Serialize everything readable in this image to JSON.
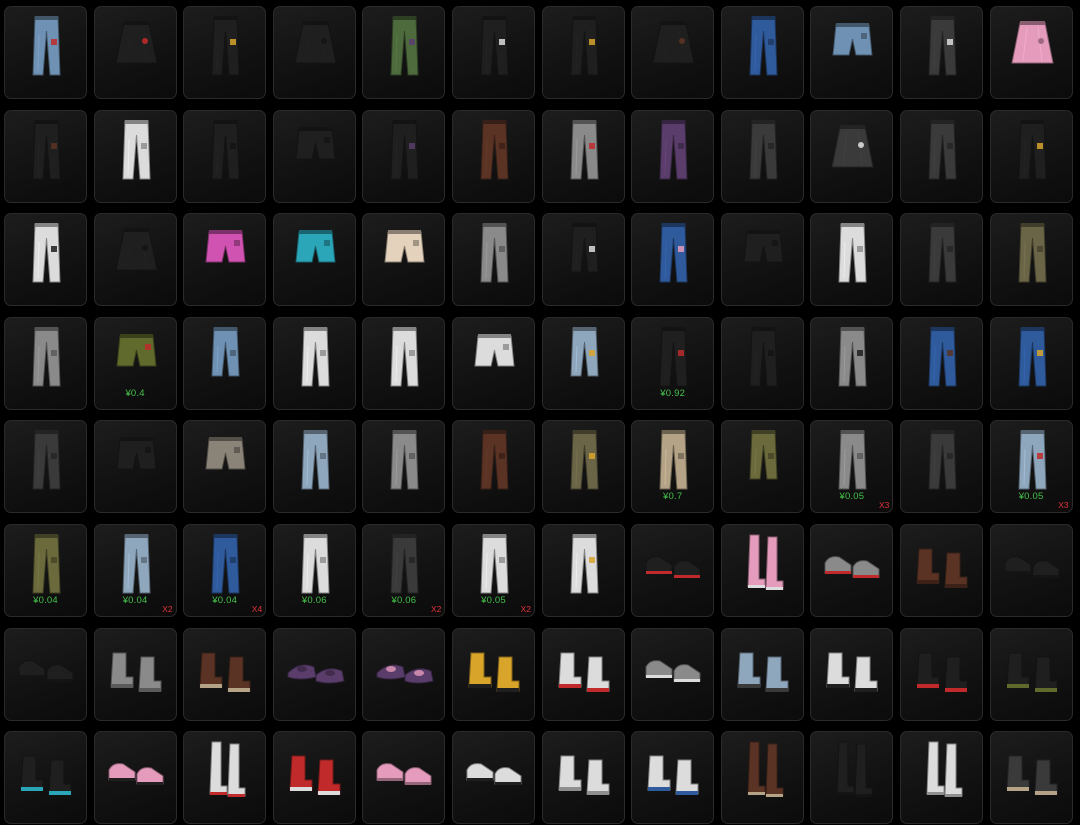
{
  "palette": {
    "green": "#4d6b3c",
    "black": "#1f1f1f",
    "darkgray": "#3a3a3a",
    "white": "#dcdcdc",
    "blue": "#2f5a9c",
    "denim": "#6f91b3",
    "lightdenim": "#8fa7bd",
    "gray": "#8a8a8a",
    "pink": "#e59bbb",
    "brown": "#5a3324",
    "tan": "#b4a386",
    "khaki": "#6b6a3c",
    "olive": "#5f6a2c",
    "camo": "#6b6547",
    "cream": "#e4d2bd",
    "teal": "#2aa6b8",
    "rainbow": "#d052b1",
    "plaid": "#8a8378",
    "purple": "#5a3d6b",
    "red": "#c02a2a",
    "yellow": "#d8a42a",
    "accent_price": "#45c24a",
    "accent_qty": "#e0343a"
  },
  "items": [
    {
      "name": "patched-jeans-icon",
      "kind": "pants",
      "color": "denim",
      "accent": "red"
    },
    {
      "name": "studded-skirt-icon",
      "kind": "skirt",
      "color": "black",
      "accent": "red"
    },
    {
      "name": "chain-pants-icon",
      "kind": "pants",
      "color": "black",
      "accent": "yellow"
    },
    {
      "name": "drape-skirt-icon",
      "kind": "skirt",
      "color": "black"
    },
    {
      "name": "green-cargo-pants-icon",
      "kind": "pants",
      "color": "green",
      "accent": "purple"
    },
    {
      "name": "strap-pants-icon",
      "kind": "pants",
      "color": "black",
      "accent": "white"
    },
    {
      "name": "stripe-pants-icon",
      "kind": "pants",
      "color": "black",
      "accent": "yellow"
    },
    {
      "name": "leather-skirt-icon",
      "kind": "skirt",
      "color": "black",
      "accent": "brown"
    },
    {
      "name": "blue-jeans-icon",
      "kind": "pants",
      "color": "blue"
    },
    {
      "name": "denim-shorts-icon",
      "kind": "shorts",
      "color": "denim"
    },
    {
      "name": "graphic-jeans-icon",
      "kind": "pants",
      "color": "darkgray",
      "accent": "white"
    },
    {
      "name": "pink-wrap-skirt-icon",
      "kind": "skirt",
      "color": "pink"
    },
    {
      "name": "ripped-pants-icon",
      "kind": "pants",
      "color": "black",
      "accent": "brown"
    },
    {
      "name": "white-pants-icon",
      "kind": "pants",
      "color": "white"
    },
    {
      "name": "black-leggings-icon",
      "kind": "pants",
      "color": "black"
    },
    {
      "name": "leather-shorts-icon",
      "kind": "shorts",
      "color": "black"
    },
    {
      "name": "tied-pants-icon",
      "kind": "pants",
      "color": "black",
      "accent": "purple"
    },
    {
      "name": "tights-icon",
      "kind": "pants",
      "color": "brown"
    },
    {
      "name": "armored-pants-icon",
      "kind": "pants",
      "color": "gray",
      "accent": "red"
    },
    {
      "name": "purple-pants-icon",
      "kind": "pants",
      "color": "purple"
    },
    {
      "name": "biker-pants-icon",
      "kind": "pants",
      "color": "darkgray"
    },
    {
      "name": "mesh-skirt-icon",
      "kind": "skirt",
      "color": "darkgray",
      "accent": "white"
    },
    {
      "name": "gray-jeans-icon",
      "kind": "pants",
      "color": "darkgray"
    },
    {
      "name": "gold-leggings-icon",
      "kind": "pants",
      "color": "black",
      "accent": "yellow"
    },
    {
      "name": "track-pants-icon",
      "kind": "pants",
      "color": "white",
      "accent": "black"
    },
    {
      "name": "pleated-skirt-icon",
      "kind": "skirt",
      "color": "black"
    },
    {
      "name": "rainbow-shorts-icon",
      "kind": "shorts",
      "color": "rainbow"
    },
    {
      "name": "teal-shorts-icon",
      "kind": "shorts",
      "color": "teal"
    },
    {
      "name": "bloomers-icon",
      "kind": "shorts",
      "color": "cream"
    },
    {
      "name": "skirt-leggings-icon",
      "kind": "pants",
      "color": "gray"
    },
    {
      "name": "black-capri-icon",
      "kind": "capri",
      "color": "black",
      "accent": "white"
    },
    {
      "name": "painted-jeans-icon",
      "kind": "pants",
      "color": "blue",
      "accent": "pink"
    },
    {
      "name": "black-shorts-icon",
      "kind": "shorts",
      "color": "black"
    },
    {
      "name": "white-leggings-icon",
      "kind": "pants",
      "color": "white"
    },
    {
      "name": "charcoal-jeans-icon",
      "kind": "pants",
      "color": "darkgray"
    },
    {
      "name": "camo-pants-icon",
      "kind": "pants",
      "color": "camo"
    },
    {
      "name": "gray-slacks-icon",
      "kind": "pants",
      "color": "gray"
    },
    {
      "name": "cargo-shorts-icon",
      "kind": "shorts",
      "color": "olive",
      "accent": "red",
      "price": "¥0.4"
    },
    {
      "name": "rolled-jeans-icon",
      "kind": "capri",
      "color": "denim"
    },
    {
      "name": "white-skinny-icon",
      "kind": "pants",
      "color": "white"
    },
    {
      "name": "light-jeans-icon",
      "kind": "pants",
      "color": "white"
    },
    {
      "name": "white-shorts-icon",
      "kind": "shorts",
      "color": "white"
    },
    {
      "name": "bleached-jeans-icon",
      "kind": "capri",
      "color": "lightdenim",
      "accent": "yellow"
    },
    {
      "name": "red-stripe-pants-icon",
      "kind": "pants",
      "color": "black",
      "accent": "red",
      "price": "¥0.92"
    },
    {
      "name": "dark-cargo-icon",
      "kind": "pants",
      "color": "black"
    },
    {
      "name": "grunge-pants-icon",
      "kind": "pants",
      "color": "gray",
      "accent": "black"
    },
    {
      "name": "holster-jeans-icon",
      "kind": "pants",
      "color": "blue",
      "accent": "brown"
    },
    {
      "name": "patch-jeans-icon",
      "kind": "pants",
      "color": "blue",
      "accent": "yellow"
    },
    {
      "name": "armor-pants-icon",
      "kind": "pants",
      "color": "darkgray"
    },
    {
      "name": "leather-long-shorts-icon",
      "kind": "shorts",
      "color": "black"
    },
    {
      "name": "plaid-shorts-icon",
      "kind": "shorts",
      "color": "plaid"
    },
    {
      "name": "faded-jeans-icon",
      "kind": "pants",
      "color": "lightdenim"
    },
    {
      "name": "gray-denim-icon",
      "kind": "pants",
      "color": "gray"
    },
    {
      "name": "brown-pants-icon",
      "kind": "pants",
      "color": "brown"
    },
    {
      "name": "camo-cargo-icon",
      "kind": "pants",
      "color": "camo",
      "accent": "yellow"
    },
    {
      "name": "khaki-cargo-icon",
      "kind": "pants",
      "color": "tan",
      "price": "¥0.7"
    },
    {
      "name": "olive-joggers-icon",
      "kind": "capri",
      "color": "khaki"
    },
    {
      "name": "gray-straight-icon",
      "kind": "pants",
      "color": "gray",
      "price": "¥0.05",
      "qty": "X3"
    },
    {
      "name": "dark-straight-icon",
      "kind": "pants",
      "color": "darkgray"
    },
    {
      "name": "red-seam-jeans-icon",
      "kind": "pants",
      "color": "lightdenim",
      "accent": "red",
      "price": "¥0.05",
      "qty": "X3"
    },
    {
      "name": "olive-pants-icon",
      "kind": "pants",
      "color": "khaki",
      "price": "¥0.04"
    },
    {
      "name": "light-wash-jeans-icon",
      "kind": "pants",
      "color": "lightdenim",
      "price": "¥0.04",
      "qty": "X2"
    },
    {
      "name": "skinny-blue-jeans-icon",
      "kind": "pants",
      "color": "blue",
      "price": "¥0.04",
      "qty": "X4"
    },
    {
      "name": "white-joggers-icon",
      "kind": "pants",
      "color": "white",
      "price": "¥0.06"
    },
    {
      "name": "black-jeans-icon",
      "kind": "pants",
      "color": "darkgray",
      "price": "¥0.06",
      "qty": "X2"
    },
    {
      "name": "white-cargo-icon",
      "kind": "pants",
      "color": "white",
      "price": "¥0.05",
      "qty": "X2"
    },
    {
      "name": "white-legwarmer-icon",
      "kind": "pants",
      "color": "white",
      "accent": "yellow"
    },
    {
      "name": "black-sneakers-icon",
      "kind": "shoes",
      "color": "black",
      "accent": "red"
    },
    {
      "name": "pink-boots-icon",
      "kind": "tallboots",
      "color": "pink",
      "accent": "white"
    },
    {
      "name": "orange-sneakers-icon",
      "kind": "shoes",
      "color": "gray",
      "accent": "red"
    },
    {
      "name": "brown-boots-icon",
      "kind": "boots",
      "color": "brown"
    },
    {
      "name": "dress-shoes-icon",
      "kind": "shoes",
      "color": "black"
    },
    {
      "name": "black-heels-icon",
      "kind": "shoes",
      "color": "black"
    },
    {
      "name": "gray-boots-icon",
      "kind": "boots",
      "color": "gray"
    },
    {
      "name": "hiking-boots-icon",
      "kind": "boots",
      "color": "brown",
      "accent": "tan"
    },
    {
      "name": "purple-slippers-icon",
      "kind": "slippers",
      "color": "purple"
    },
    {
      "name": "mauve-slippers-icon",
      "kind": "slippers",
      "color": "purple",
      "accent": "pink"
    },
    {
      "name": "yellow-sneakers-icon",
      "kind": "boots",
      "color": "yellow",
      "accent": "black"
    },
    {
      "name": "red-white-sneakers-icon",
      "kind": "boots",
      "color": "white",
      "accent": "red"
    },
    {
      "name": "gray-slip-ons-icon",
      "kind": "shoes",
      "color": "gray",
      "accent": "white"
    },
    {
      "name": "blue-gray-boots-icon",
      "kind": "boots",
      "color": "lightdenim",
      "accent": "darkgray"
    },
    {
      "name": "white-platform-boots-icon",
      "kind": "boots",
      "color": "white",
      "accent": "black"
    },
    {
      "name": "black-red-boots-icon",
      "kind": "boots",
      "color": "black",
      "accent": "red"
    },
    {
      "name": "neon-boots-icon",
      "kind": "boots",
      "color": "black",
      "accent": "olive"
    },
    {
      "name": "cyan-platform-boots-icon",
      "kind": "boots",
      "color": "black",
      "accent": "teal"
    },
    {
      "name": "pink-sandals-icon",
      "kind": "shoes",
      "color": "pink",
      "accent": "black"
    },
    {
      "name": "white-socks-shoes-icon",
      "kind": "tallboots",
      "color": "white",
      "accent": "red"
    },
    {
      "name": "red-high-tops-icon",
      "kind": "boots",
      "color": "red",
      "accent": "white"
    },
    {
      "name": "pink-flats-icon",
      "kind": "shoes",
      "color": "pink"
    },
    {
      "name": "black-white-sneakers-icon",
      "kind": "shoes",
      "color": "white",
      "accent": "black"
    },
    {
      "name": "white-sneakers-icon",
      "kind": "boots",
      "color": "white"
    },
    {
      "name": "blue-sneakers-icon",
      "kind": "boots",
      "color": "white",
      "accent": "blue"
    },
    {
      "name": "lace-up-heels-icon",
      "kind": "tallboots",
      "color": "brown",
      "accent": "tan"
    },
    {
      "name": "black-thigh-boots-icon",
      "kind": "tallboots",
      "color": "black"
    },
    {
      "name": "white-tall-boots-icon",
      "kind": "tallboots",
      "color": "white"
    },
    {
      "name": "spiked-boots-icon",
      "kind": "boots",
      "color": "darkgray",
      "accent": "tan"
    }
  ]
}
